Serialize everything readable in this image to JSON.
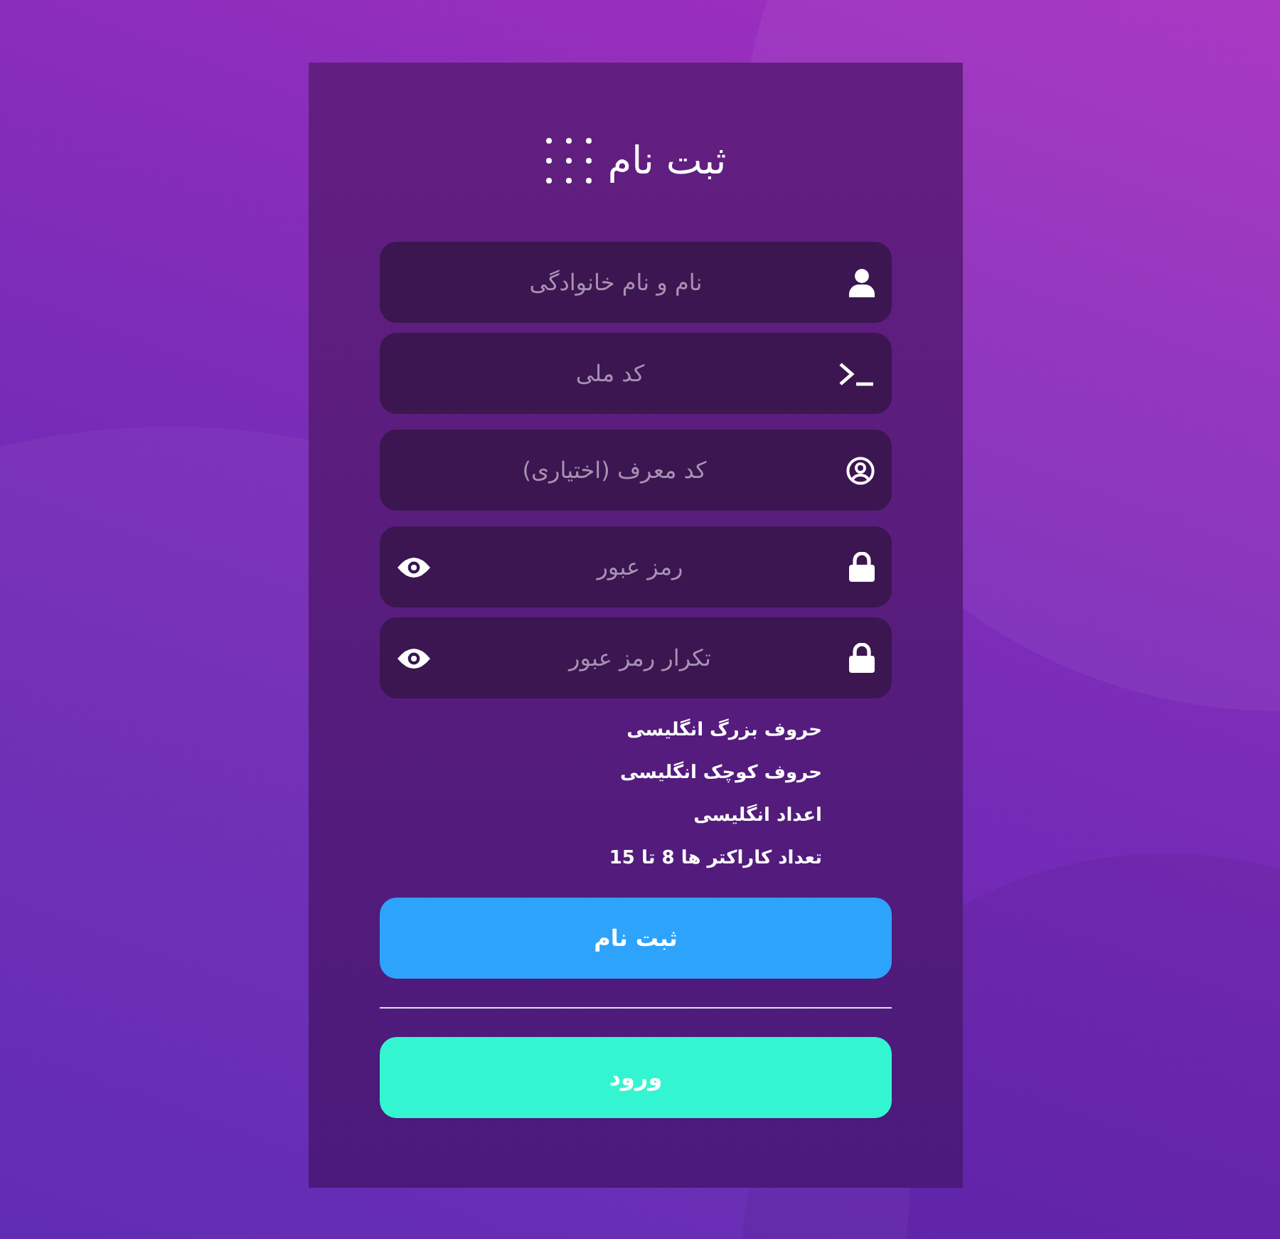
{
  "title": "ثبت نام",
  "fields": [
    {
      "kind": "name",
      "placeholder": "نام و نام خانوادگی"
    },
    {
      "kind": "national-id",
      "placeholder": "کد ملی"
    },
    {
      "kind": "referral",
      "placeholder": "کد معرف (اختیاری)"
    },
    {
      "kind": "password",
      "placeholder": "رمز عبور"
    },
    {
      "kind": "password",
      "placeholder": "تکرار رمز عبور"
    }
  ],
  "password_rules": [
    "حروف بزرگ انگلیسی",
    "حروف کوچک انگلیسی",
    "اعداد انگلیسی",
    "تعداد کاراکتر ها 8 تا 15"
  ],
  "buttons": [
    {
      "kind": "primary",
      "label": "ثبت نام"
    },
    {
      "kind": "secondary",
      "label": "ورود"
    }
  ]
}
